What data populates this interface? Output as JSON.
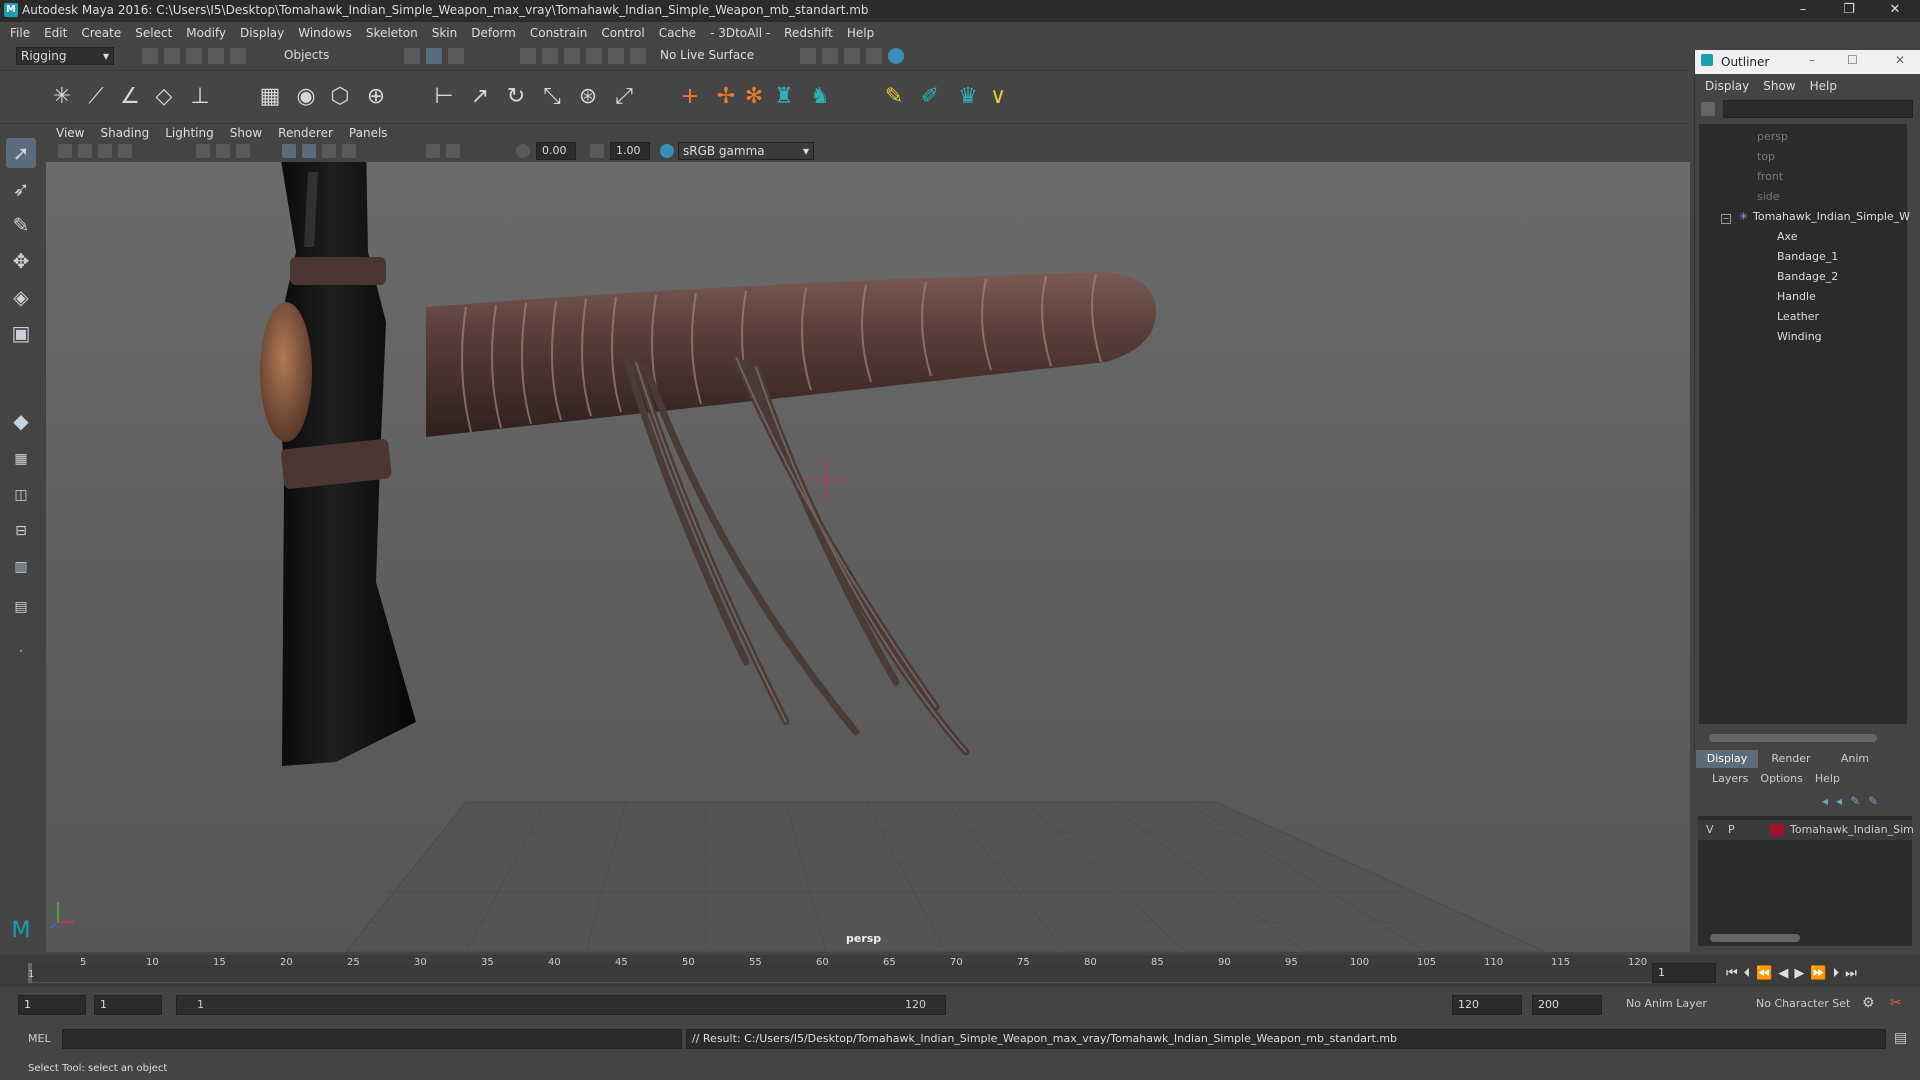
{
  "app": {
    "title": "Autodesk Maya 2016: C:\\Users\\I5\\Desktop\\Tomahawk_Indian_Simple_Weapon_max_vray\\Tomahawk_Indian_Simple_Weapon_mb_standart.mb",
    "logo": "M"
  },
  "window_controls": {
    "minimize": "–",
    "restore": "❐",
    "close": "✕"
  },
  "menubar": [
    "File",
    "Edit",
    "Create",
    "Select",
    "Modify",
    "Display",
    "Windows",
    "Skeleton",
    "Skin",
    "Deform",
    "Constrain",
    "Control",
    "Cache",
    "- 3DtoAll -",
    "Redshift",
    "Help"
  ],
  "statusline": {
    "menu_set": "Rigging",
    "selection_mode": "Objects",
    "live_surface": "No Live Surface"
  },
  "panel_menu": [
    "View",
    "Shading",
    "Lighting",
    "Show",
    "Renderer",
    "Panels"
  ],
  "view_tools": {
    "exposure": "0.00",
    "gamma": "1.00",
    "color_space": "sRGB gamma"
  },
  "viewport": {
    "camera_label": "persp"
  },
  "timeline": {
    "ticks": [
      "1",
      "5",
      "10",
      "15",
      "20",
      "25",
      "30",
      "35",
      "40",
      "45",
      "50",
      "55",
      "60",
      "65",
      "70",
      "75",
      "80",
      "85",
      "90",
      "95",
      "100",
      "105",
      "110",
      "115",
      "120"
    ],
    "current_frame": "1"
  },
  "range": {
    "start": "1",
    "playback_start": "1",
    "slider_start": "1",
    "slider_end": "120",
    "playback_end": "120",
    "end": "200",
    "anim_layer": "No Anim Layer",
    "character_set": "No Character Set"
  },
  "cmdline": {
    "language": "MEL",
    "result": "// Result: C:/Users/I5/Desktop/Tomahawk_Indian_Simple_Weapon_max_vray/Tomahawk_Indian_Simple_Weapon_mb_standart.mb"
  },
  "helpline": "Select Tool: select an object",
  "outliner": {
    "title": "Outliner",
    "menu": [
      "Display",
      "Show",
      "Help"
    ],
    "cameras": [
      "persp",
      "top",
      "front",
      "side"
    ],
    "group": "Tomahawk_Indian_Simple_W",
    "children": [
      "Axe",
      "Bandage_1",
      "Bandage_2",
      "Handle",
      "Leather",
      "Winding"
    ]
  },
  "layer_editor": {
    "tabs": [
      "Display",
      "Render",
      "Anim"
    ],
    "menu": [
      "Layers",
      "Options",
      "Help"
    ],
    "layer": {
      "v": "V",
      "p": "P",
      "name": "Tomahawk_Indian_Sim",
      "color": "#a0102a"
    }
  },
  "colors": {
    "accent": "#5b6d7d",
    "brand": "#1a9fb0"
  }
}
